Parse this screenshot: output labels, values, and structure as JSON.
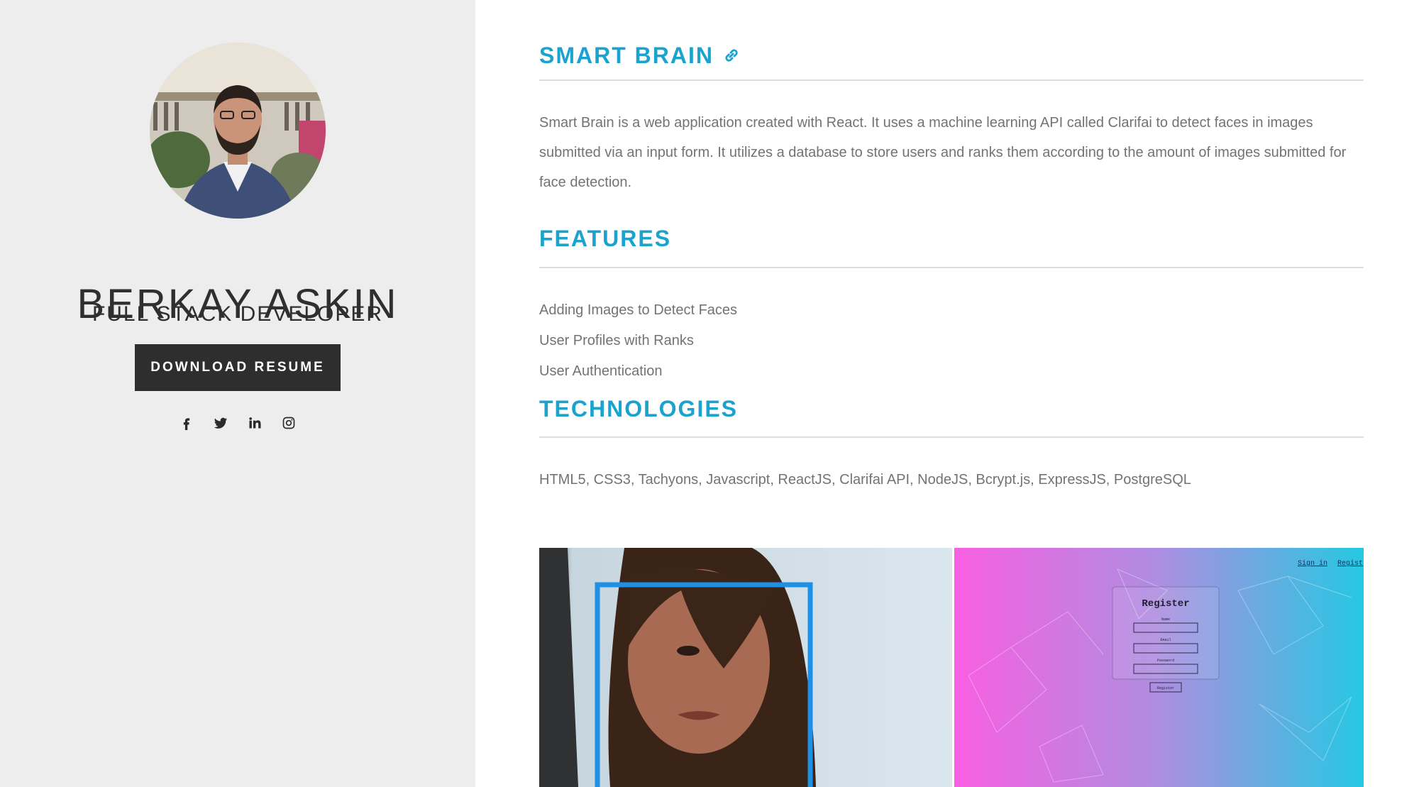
{
  "profile": {
    "name": "BERKAY ASKIN",
    "role": "FULL STACK DEVELOPER",
    "resume_button": "DOWNLOAD RESUME",
    "socials": [
      {
        "icon": "facebook-icon"
      },
      {
        "icon": "twitter-icon"
      },
      {
        "icon": "linkedin-icon"
      },
      {
        "icon": "instagram-icon"
      }
    ]
  },
  "project": {
    "title": "SMART BRAIN",
    "title_icon": "link-icon",
    "description": "Smart Brain is a web application created with React. It uses a machine learning API called Clarifai to detect faces in images submitted via an input form. It utilizes a database to store users and ranks them according to the amount of images submitted for face detection.",
    "features_title": "FEATURES",
    "features": [
      "Adding Images to Detect Faces",
      "User Profiles with Ranks",
      "User Authentication"
    ],
    "technologies_title": "TECHNOLOGIES",
    "technologies": "HTML5, CSS3, Tachyons, Javascript, ReactJS, Clarifai API, NodeJS, Bcrypt.js, ExpressJS, PostgreSQL"
  },
  "screenshots": {
    "register_nav": [
      "Sign in",
      "Regist"
    ],
    "register_title": "Register",
    "register_fields": [
      "Name",
      "Email",
      "Password"
    ],
    "register_button": "Register"
  },
  "colors": {
    "accent": "#1aa3cf",
    "sidebar_bg": "#ededed",
    "button_bg": "#2e2e2e",
    "text_muted": "#737373"
  }
}
